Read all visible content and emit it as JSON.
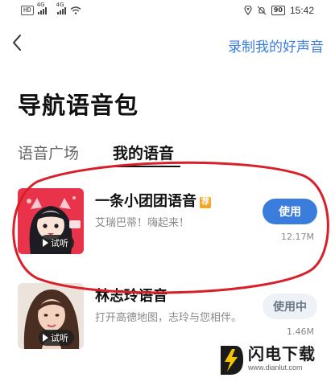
{
  "status_bar": {
    "hd_label": "HD",
    "network_1": "4G",
    "network_2": "4G",
    "battery": "90",
    "time": "15:42"
  },
  "header": {
    "back_icon": "chevron-left-icon",
    "record_link": "录制我的好声音"
  },
  "page_title": "导航语音包",
  "tabs": [
    {
      "label": "语音广场",
      "active": false
    },
    {
      "label": "我的语音",
      "active": true
    }
  ],
  "packs": [
    {
      "name": "一条小团团语音",
      "badge": "荐",
      "description": "艾瑞巴蒂！嗨起来！",
      "listen_label": "试听",
      "action_label": "使用",
      "size": "12.17M"
    },
    {
      "name": "林志玲语音",
      "description": "打开高德地图，志玲与您相伴。",
      "listen_label": "试听",
      "action_label": "使用中",
      "size": "1.46M"
    }
  ],
  "watermark": {
    "name": "闪电下载",
    "url": "www.dianlut.com"
  },
  "colors": {
    "accent": "#3b7ddd",
    "badge": "#f5a623",
    "annotation": "#d9202a"
  }
}
